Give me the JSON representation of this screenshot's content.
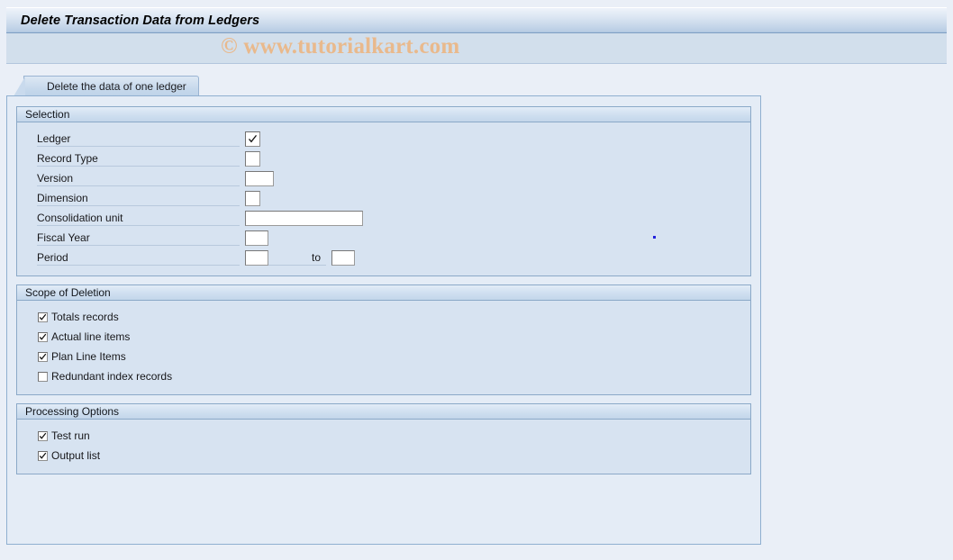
{
  "window": {
    "title": "Delete Transaction Data from Ledgers",
    "watermark": "© www.tutorialkart.com"
  },
  "tabs": [
    {
      "label": "Delete the data of one ledger",
      "active": true
    }
  ],
  "panels": {
    "selection": {
      "title": "Selection",
      "fields": [
        {
          "label": "Ledger",
          "value": "",
          "control": "checkbox-field",
          "checked": true,
          "size": "tiny"
        },
        {
          "label": "Record Type",
          "value": "",
          "control": "input",
          "size": "tiny"
        },
        {
          "label": "Version",
          "value": "",
          "control": "input",
          "size": "med"
        },
        {
          "label": "Dimension",
          "value": "",
          "control": "input",
          "size": "tiny"
        },
        {
          "label": "Consolidation unit",
          "value": "",
          "control": "input",
          "size": "wide"
        },
        {
          "label": "Fiscal Year",
          "value": "",
          "control": "input",
          "size": "small"
        },
        {
          "label": "Period",
          "value": "",
          "control": "range",
          "size": "small",
          "to_label": "to",
          "to_value": "",
          "to_size": "small"
        }
      ]
    },
    "scope_of_deletion": {
      "title": "Scope of Deletion",
      "options": [
        {
          "label": "Totals records",
          "checked": true
        },
        {
          "label": "Actual line items",
          "checked": true
        },
        {
          "label": "Plan Line Items",
          "checked": true
        },
        {
          "label": "Redundant index records",
          "checked": false
        }
      ]
    },
    "processing_options": {
      "title": "Processing Options",
      "options": [
        {
          "label": "Test run",
          "checked": true
        },
        {
          "label": "Output list",
          "checked": true
        }
      ]
    }
  },
  "colors": {
    "page_background": "#eaeff7",
    "panel_background": "#d7e3f1",
    "content_background": "#e4ecf6",
    "panel_border": "#8ba9c8",
    "titlebar_gradient_end": "#a8c0dc",
    "watermark_color": "#e9b98c",
    "text_color": "#17171a"
  }
}
